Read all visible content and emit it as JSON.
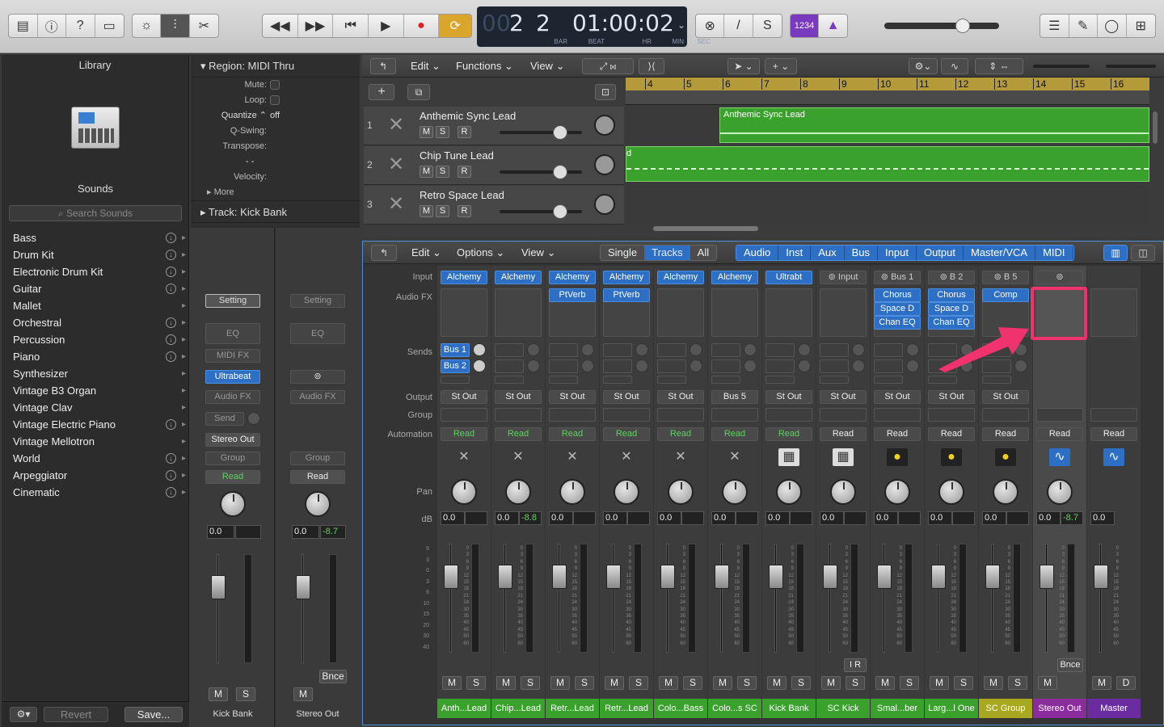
{
  "toolbar": {
    "lcd": {
      "bar": "2",
      "beat": "2",
      "bar_label": "BAR",
      "beat_label": "BEAT",
      "time": "01:00:02",
      "hr": "HR",
      "min": "MIN",
      "sec": "SEC"
    },
    "key_label": "1234"
  },
  "library": {
    "title": "Library",
    "sounds_title": "Sounds",
    "search_placeholder": "Search Sounds",
    "items": [
      "Bass",
      "Drum Kit",
      "Electronic Drum Kit",
      "Guitar",
      "Mallet",
      "Orchestral",
      "Percussion",
      "Piano",
      "Synthesizer",
      "Vintage B3 Organ",
      "Vintage Clav",
      "Vintage Electric Piano",
      "Vintage Mellotron",
      "World",
      "Arpeggiator",
      "Cinematic"
    ],
    "revert": "Revert",
    "save": "Save..."
  },
  "inspector": {
    "region_title": "Region: MIDI Thru",
    "mute": "Mute:",
    "loop": "Loop:",
    "quantize": "Quantize",
    "quantize_val": "off",
    "qswing": "Q-Swing:",
    "transpose": "Transpose:",
    "velocity": "Velocity:",
    "dashes": "- -",
    "more": "More",
    "track_title": "Track:",
    "track_name": "Kick Bank",
    "strip1": {
      "setting": "Setting",
      "eq": "EQ",
      "midifx": "MIDI FX",
      "inst": "Ultrabeat",
      "audiofx": "Audio FX",
      "send": "Send",
      "output": "Stereo Out",
      "group": "Group",
      "auto": "Read",
      "db": "0.0",
      "m": "M",
      "s": "S",
      "name": "Kick Bank"
    },
    "strip2": {
      "setting": "Setting",
      "eq": "EQ",
      "audiofx": "Audio FX",
      "group": "Group",
      "auto": "Read",
      "db": "0.0",
      "peak": "-8.7",
      "bnce": "Bnce",
      "m": "M",
      "name": "Stereo Out"
    }
  },
  "tracks": {
    "menu": {
      "edit": "Edit",
      "functions": "Functions",
      "view": "View"
    },
    "ruler": [
      "4",
      "5",
      "6",
      "7",
      "8",
      "9",
      "10",
      "11",
      "12",
      "13",
      "14",
      "15",
      "16"
    ],
    "rows": [
      {
        "num": "1",
        "name": "Anthemic Sync Lead"
      },
      {
        "num": "2",
        "name": "Chip Tune Lead"
      },
      {
        "num": "3",
        "name": "Retro Space Lead"
      }
    ],
    "msr": {
      "m": "M",
      "s": "S",
      "r": "R"
    },
    "region1": "Anthemic Sync Lead",
    "region2": "d"
  },
  "mixer": {
    "menu": {
      "edit": "Edit",
      "options": "Options",
      "view": "View"
    },
    "modes": [
      "Single",
      "Tracks",
      "All"
    ],
    "filters": [
      "Audio",
      "Inst",
      "Aux",
      "Bus",
      "Input",
      "Output",
      "Master/VCA",
      "MIDI"
    ],
    "labels": {
      "input": "Input",
      "audiofx": "Audio FX",
      "sends": "Sends",
      "output": "Output",
      "group": "Group",
      "automation": "Automation",
      "pan": "Pan",
      "db": "dB"
    },
    "scale": [
      "0",
      "3",
      "6",
      "9",
      "12",
      "15",
      "18",
      "21",
      "24",
      "30",
      "35",
      "40",
      "45",
      "50",
      "60"
    ],
    "left_scale": [
      "6",
      "3",
      "0",
      "3",
      "6",
      "10",
      "15",
      "20",
      "30",
      "40"
    ],
    "channels": [
      {
        "input": "Alchemy",
        "fx": [],
        "sends": [
          "Bus 1",
          "Bus 2"
        ],
        "output": "St Out",
        "auto": "Read",
        "db": "0.0",
        "peak": "",
        "name": "Anth...Lead",
        "color": "#3aa12c"
      },
      {
        "input": "Alchemy",
        "fx": [],
        "sends": [],
        "output": "St Out",
        "auto": "Read",
        "db": "0.0",
        "peak": "-8.8",
        "name": "Chip...Lead",
        "color": "#3aa12c"
      },
      {
        "input": "Alchemy",
        "fx": [
          "PtVerb"
        ],
        "sends": [],
        "output": "St Out",
        "auto": "Read",
        "db": "0.0",
        "peak": "",
        "name": "Retr...Lead",
        "color": "#3aa12c"
      },
      {
        "input": "Alchemy",
        "fx": [
          "PtVerb"
        ],
        "sends": [],
        "output": "St Out",
        "auto": "Read",
        "db": "0.0",
        "peak": "",
        "name": "Retr...Lead",
        "color": "#3aa12c"
      },
      {
        "input": "Alchemy",
        "fx": [],
        "sends": [],
        "output": "St Out",
        "auto": "Read",
        "db": "0.0",
        "peak": "",
        "name": "Colo...Bass",
        "color": "#3aa12c"
      },
      {
        "input": "Alchemy",
        "fx": [],
        "sends": [],
        "output": "Bus 5",
        "auto": "Read",
        "db": "0.0",
        "peak": "",
        "name": "Colo...s SC",
        "color": "#3aa12c"
      },
      {
        "input": "Ultrabt",
        "fx": [],
        "sends": [],
        "output": "St Out",
        "auto": "Read",
        "db": "0.0",
        "peak": "",
        "name": "Kick Bank",
        "color": "#3aa12c"
      },
      {
        "input": "Input",
        "fx": [],
        "sends": [],
        "output": "St Out",
        "auto": "Read",
        "db": "0.0",
        "peak": "",
        "name": "SC Kick",
        "color": "#3aa12c",
        "ir": "I  R"
      },
      {
        "input": "Bus 1",
        "fx": [
          "Chorus",
          "Space D",
          "Chan EQ"
        ],
        "sends": [],
        "output": "St Out",
        "auto": "Read",
        "db": "0.0",
        "peak": "",
        "name": "Smal...ber",
        "color": "#3aa12c"
      },
      {
        "input": "B 2",
        "fx": [
          "Chorus",
          "Space D",
          "Chan EQ"
        ],
        "sends": [],
        "output": "St Out",
        "auto": "Read",
        "db": "0.0",
        "peak": "",
        "name": "Larg...l One",
        "color": "#3aa12c"
      },
      {
        "input": "B 5",
        "fx": [
          "Comp"
        ],
        "sends": [],
        "output": "St Out",
        "auto": "Read",
        "db": "0.0",
        "peak": "",
        "name": "SC Group",
        "color": "#a8a820"
      },
      {
        "input": "",
        "fx": [],
        "sends": [],
        "output": "",
        "auto": "Read",
        "db": "0.0",
        "peak": "-8.7",
        "name": "Stereo Out",
        "color": "#8a2c9c",
        "bnce": "Bnce"
      },
      {
        "input": "",
        "fx": [],
        "sends": [],
        "output": "",
        "auto": "Read",
        "db": "0.0",
        "peak": "",
        "name": "Master",
        "color": "#6a2ca0"
      }
    ]
  }
}
